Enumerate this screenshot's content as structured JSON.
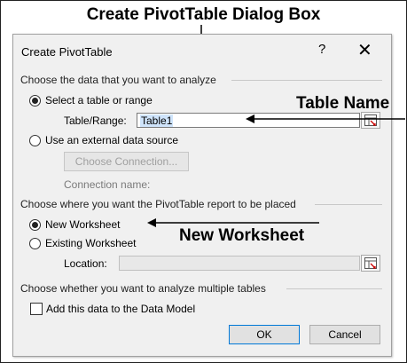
{
  "annotations": {
    "heading": "Create PivotTable Dialog Box",
    "table_name": "Table Name",
    "new_worksheet": "New Worksheet"
  },
  "dialog": {
    "title": "Create PivotTable",
    "help_glyph": "?",
    "close_glyph": "✕"
  },
  "source": {
    "group_label": "Choose the data that you want to analyze",
    "option_table": "Select a table or range",
    "table_range_label": "Table/Range:",
    "table_range_value": "Table1",
    "option_external": "Use an external data source",
    "choose_connection_button": "Choose Connection...",
    "connection_name_label": "Connection name:"
  },
  "placement": {
    "group_label": "Choose where you want the PivotTable report to be placed",
    "option_new": "New Worksheet",
    "option_existing": "Existing Worksheet",
    "location_label": "Location:",
    "location_value": ""
  },
  "multiple": {
    "group_label": "Choose whether you want to analyze multiple tables",
    "data_model_checkbox": "Add this data to the Data Model"
  },
  "buttons": {
    "ok": "OK",
    "cancel": "Cancel"
  },
  "icons": {
    "help": "help-icon",
    "close": "close-icon",
    "collapse": "range-collapse-icon"
  }
}
